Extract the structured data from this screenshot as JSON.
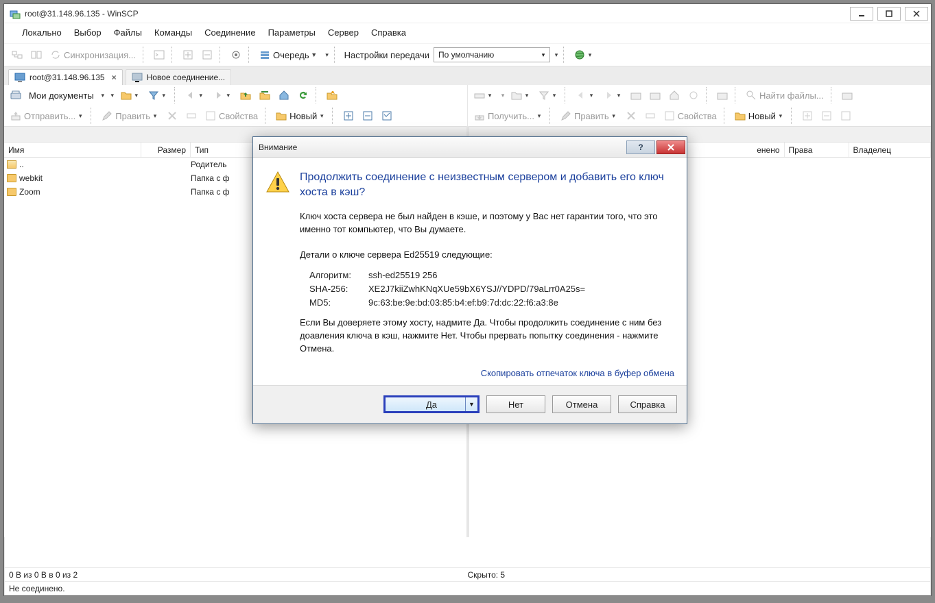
{
  "title": "root@31.148.96.135 - WinSCP",
  "menu": [
    "Локально",
    "Выбор",
    "Файлы",
    "Команды",
    "Соединение",
    "Параметры",
    "Сервер",
    "Справка"
  ],
  "toolbar1": {
    "sync": "Синхронизация...",
    "queue": "Очередь",
    "transfer_label": "Настройки передачи",
    "transfer_preset": "По умолчанию"
  },
  "tabs": [
    {
      "label": "root@31.148.96.135",
      "closable": true
    },
    {
      "label": "Новое соединение...",
      "closable": false
    }
  ],
  "left": {
    "location": "Мои документы",
    "upload_btn": "Отправить...",
    "edit_btn": "Править",
    "props_btn": "Свойства",
    "new_btn": "Новый",
    "cols": {
      "name": "Имя",
      "size": "Размер",
      "type": "Тип"
    },
    "rows": [
      {
        "name": "..",
        "type": "Родитель",
        "icon": "up"
      },
      {
        "name": "webkit",
        "type": "Папка с ф",
        "icon": "folder"
      },
      {
        "name": "Zoom",
        "type": "Папка с ф",
        "icon": "folder"
      }
    ]
  },
  "right": {
    "download_btn": "Получить...",
    "edit_btn": "Править",
    "props_btn": "Свойства",
    "new_btn": "Новый",
    "find_btn": "Найти файлы...",
    "cols": {
      "changed": "енено",
      "rights": "Права",
      "owner": "Владелец"
    }
  },
  "status": {
    "left": "0 B из 0 B в 0 из 2",
    "right": "Скрыто: 5",
    "conn": "Не соединено."
  },
  "dialog": {
    "title": "Внимание",
    "heading": "Продолжить соединение с неизвестным сервером и добавить его ключ хоста в кэш?",
    "para1": "Ключ хоста сервера не был найден в кэше, и поэтому у Вас нет гарантии того, что это именно тот компьютер, что Вы думаете.",
    "para2": "Детали о ключе сервера Ed25519 следующие:",
    "algo_lbl": "Алгоритм:",
    "algo_val": "ssh-ed25519 256",
    "sha_lbl": "SHA-256:",
    "sha_val": "XE2J7kiiZwhKNqXUe59bX6YSJ//YDPD/79aLrr0A25s=",
    "md5_lbl": "MD5:",
    "md5_val": "9c:63:be:9e:bd:03:85:b4:ef:b9:7d:dc:22:f6:a3:8e",
    "para3": "Если Вы доверяете этому хосту, надмите Да. Чтобы продолжить соединение с ним без доавления ключа в кэш, нажмите Нет. Чтобы прервать попытку соединения - нажмите Отмена.",
    "link": "Скопировать отпечаток ключа в буфер обмена",
    "yes": "Да",
    "no": "Нет",
    "cancel": "Отмена",
    "help": "Справка"
  }
}
